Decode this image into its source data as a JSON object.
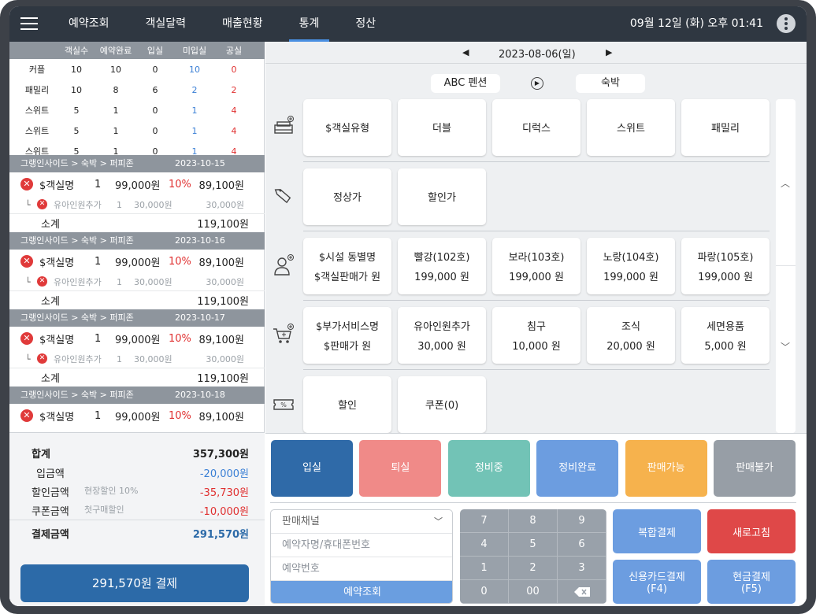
{
  "topbar": {
    "nav": [
      "예약조회",
      "객실달력",
      "매출현황",
      "통계",
      "정산"
    ],
    "active_index": 3,
    "clock": "09월 12일 (화)  오후 01:41"
  },
  "summary": {
    "headers": [
      "객실수",
      "예약완료",
      "입실",
      "미입실",
      "공실"
    ],
    "rows": [
      {
        "name": "커플",
        "rooms": "10",
        "reserved": "10",
        "checkin": "0",
        "pending": "10",
        "vacant": "0"
      },
      {
        "name": "패밀리",
        "rooms": "10",
        "reserved": "8",
        "checkin": "6",
        "pending": "2",
        "vacant": "2"
      },
      {
        "name": "스위트",
        "rooms": "5",
        "reserved": "1",
        "checkin": "0",
        "pending": "1",
        "vacant": "4"
      },
      {
        "name": "스위트",
        "rooms": "5",
        "reserved": "1",
        "checkin": "0",
        "pending": "1",
        "vacant": "4"
      },
      {
        "name": "스위트",
        "rooms": "5",
        "reserved": "1",
        "checkin": "0",
        "pending": "1",
        "vacant": "4"
      }
    ]
  },
  "reservations": [
    {
      "header": "그랭인사이드 > 숙박 > 퍼피존",
      "date": "2023-10-15",
      "room": "$객실명",
      "qty": "1",
      "price": "99,000원",
      "rate": "10%",
      "amount": "89,100원",
      "extra_name": "유아인원추가",
      "extra_qty": "1",
      "extra_price": "30,000원",
      "extra_amount": "30,000원",
      "subtotal_label": "소계",
      "subtotal": "119,100원"
    },
    {
      "header": "그랭인사이드 > 숙박 > 퍼피존",
      "date": "2023-10-16",
      "room": "$객실명",
      "qty": "1",
      "price": "99,000원",
      "rate": "10%",
      "amount": "89,100원",
      "extra_name": "유아인원추가",
      "extra_qty": "1",
      "extra_price": "30,000원",
      "extra_amount": "30,000원",
      "subtotal_label": "소계",
      "subtotal": "119,100원"
    },
    {
      "header": "그랭인사이드 > 숙박 > 퍼피존",
      "date": "2023-10-17",
      "room": "$객실명",
      "qty": "1",
      "price": "99,000원",
      "rate": "10%",
      "amount": "89,100원",
      "extra_name": "유아인원추가",
      "extra_qty": "1",
      "extra_price": "30,000원",
      "extra_amount": "30,000원",
      "subtotal_label": "소계",
      "subtotal": "119,100원"
    },
    {
      "header": "그랭인사이드 > 숙박 > 퍼피존",
      "date": "2023-10-18",
      "room": "$객실명",
      "qty": "1",
      "price": "99,000원",
      "rate": "10%",
      "amount": "89,100원"
    }
  ],
  "totals": {
    "sum_label": "합계",
    "sum": "357,300원",
    "deposit_label": "입금액",
    "deposit": "-20,000원",
    "discount_label": "할인금액",
    "discount_note": "현장할인 10%",
    "discount": "-35,730원",
    "coupon_label": "쿠폰금액",
    "coupon_note": "첫구매할인",
    "coupon": "-10,000원",
    "final_label": "결제금액",
    "final": "291,570원"
  },
  "pay_button": "291,570원  결제",
  "date_nav": {
    "prev": "◀",
    "date": "2023-08-06(일)",
    "next": "▶"
  },
  "property": "ABC 펜션",
  "stay_type": "숙박",
  "categories": {
    "room_types": [
      {
        "l1": "$객실유형"
      },
      {
        "l1": "더블"
      },
      {
        "l1": "디럭스"
      },
      {
        "l1": "스위트"
      },
      {
        "l1": "패밀리"
      }
    ],
    "pricing": [
      {
        "l1": "정상가"
      },
      {
        "l1": "할인가"
      }
    ],
    "rooms": [
      {
        "l1": "$시설 동별명",
        "l2": "$객실판매가 원"
      },
      {
        "l1": "빨강(102호)",
        "l2": "199,000 원"
      },
      {
        "l1": "보라(103호)",
        "l2": "199,000 원"
      },
      {
        "l1": "노랑(104호)",
        "l2": "199,000 원"
      },
      {
        "l1": "파랑(105호)",
        "l2": "199,000 원"
      }
    ],
    "services": [
      {
        "l1": "$부가서비스명",
        "l2": "$판매가 원"
      },
      {
        "l1": "유아인원추가",
        "l2": "30,000 원"
      },
      {
        "l1": "침구",
        "l2": "10,000 원"
      },
      {
        "l1": "조식",
        "l2": "20,000 원"
      },
      {
        "l1": "세면용품",
        "l2": "5,000 원"
      }
    ],
    "discounts": [
      {
        "l1": "할인"
      },
      {
        "l1": "쿠폰(0)"
      }
    ]
  },
  "status_buttons": [
    {
      "label": "입실",
      "color": "#2f6aa8"
    },
    {
      "label": "퇴실",
      "color": "#f08a88"
    },
    {
      "label": "정비중",
      "color": "#72c3b6"
    },
    {
      "label": "정비완료",
      "color": "#6c9de0"
    },
    {
      "label": "판매가능",
      "color": "#f6b24d"
    },
    {
      "label": "판매불가",
      "color": "#979ea6"
    }
  ],
  "search": {
    "channel": "판매채널",
    "name_phone": "예약자명/휴대폰번호",
    "res_number": "예약번호",
    "button": "예약조회"
  },
  "numpad": [
    "7",
    "8",
    "9",
    "4",
    "5",
    "6",
    "1",
    "2",
    "3",
    "0",
    "00"
  ],
  "actions": {
    "combined": "복합결제",
    "refresh": "새로고침",
    "card_l1": "신용카드결제",
    "card_l2": "(F4)",
    "cash_l1": "현금결제",
    "cash_l2": "(F5)"
  },
  "icons": {
    "menu": "hamburger-icon",
    "more": "more-vertical-icon",
    "delete": "backspace-icon"
  }
}
